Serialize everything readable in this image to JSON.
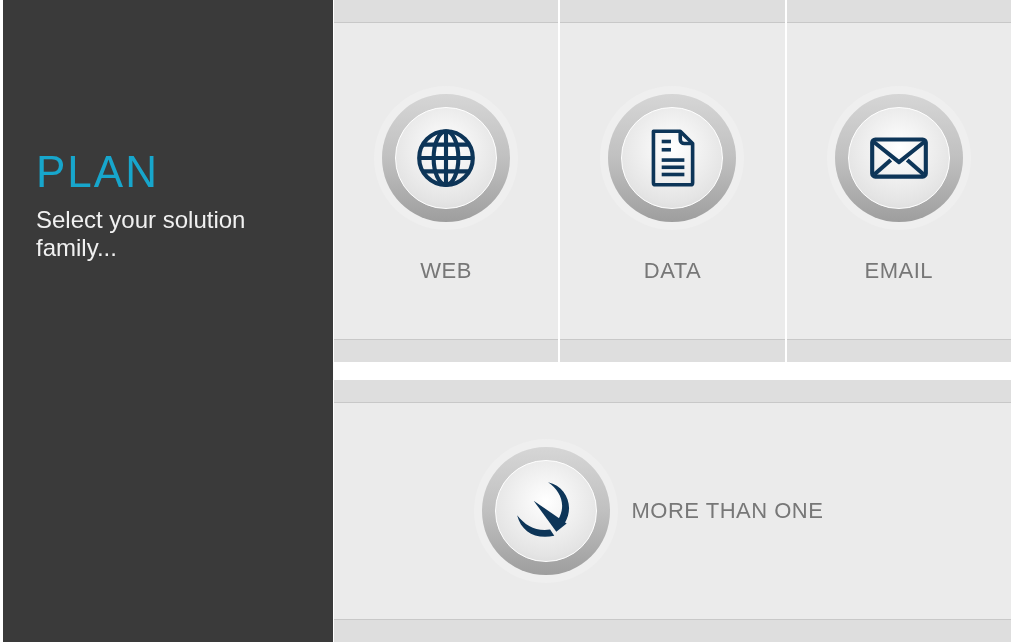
{
  "sidebar": {
    "title": "PLAN",
    "subtitle": "Select your solution family..."
  },
  "options": [
    {
      "label": "WEB",
      "kind": "globe"
    },
    {
      "label": "DATA",
      "kind": "document"
    },
    {
      "label": "EMAIL",
      "kind": "envelope"
    }
  ],
  "wide_option": {
    "label": "MORE THAN ONE",
    "kind": "logo"
  }
}
